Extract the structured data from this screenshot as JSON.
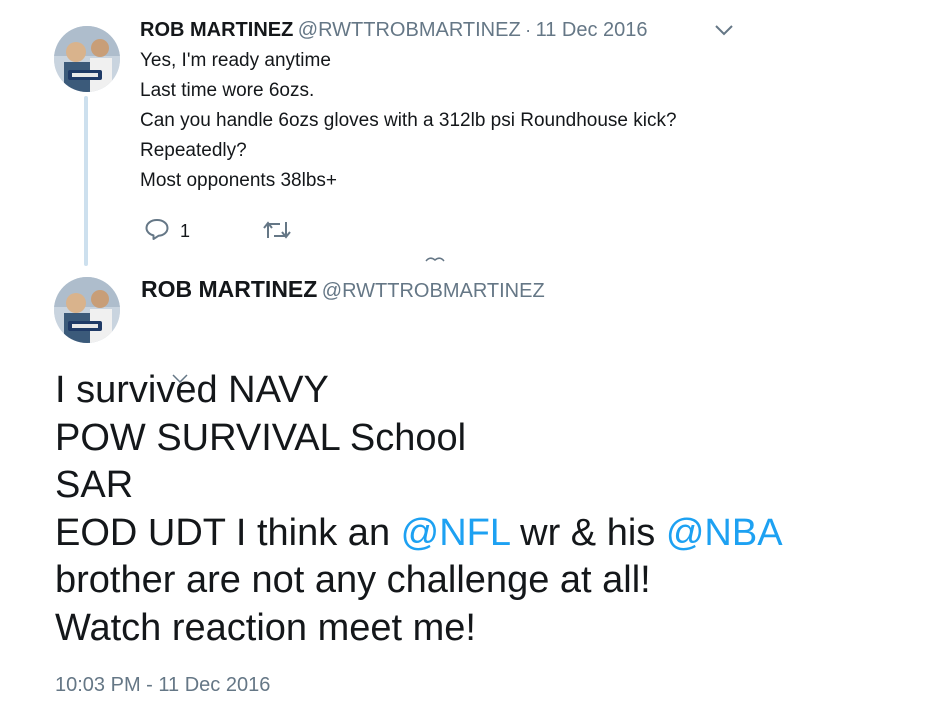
{
  "reply_tweet": {
    "author_name": "ROB MARTINEZ",
    "author_handle": "@RWTTROBMARTINEZ",
    "separator": "·",
    "date": "11 Dec 2016",
    "lines": [
      "Yes, I'm ready anytime",
      "Last time wore 6ozs.",
      "Can you handle 6ozs gloves with a 312lb psi Roundhouse kick?",
      "Repeatedly?",
      "Most opponents 38lbs+"
    ],
    "reply_count": "1",
    "icons": [
      "reply-icon",
      "retweet-icon",
      "chevron-down-icon"
    ]
  },
  "main_tweet": {
    "author_name": "ROB MARTINEZ",
    "author_handle": "@RWTTROBMARTINEZ",
    "line1": "I survived NAVY",
    "line2": "POW SURVIVAL School",
    "line3": "SAR",
    "line4_pre": "EOD UDT I think an ",
    "mention1": "@NFL",
    "line4_mid": " wr & his ",
    "mention2": "@NBA",
    "line5": "brother are not any challenge at all!",
    "line6": "Watch reaction meet me!",
    "timestamp": "10:03 PM - 11 Dec 2016"
  },
  "colors": {
    "mention": "#1da1f2",
    "muted": "#657786",
    "thread_line": "#cde0ee"
  }
}
